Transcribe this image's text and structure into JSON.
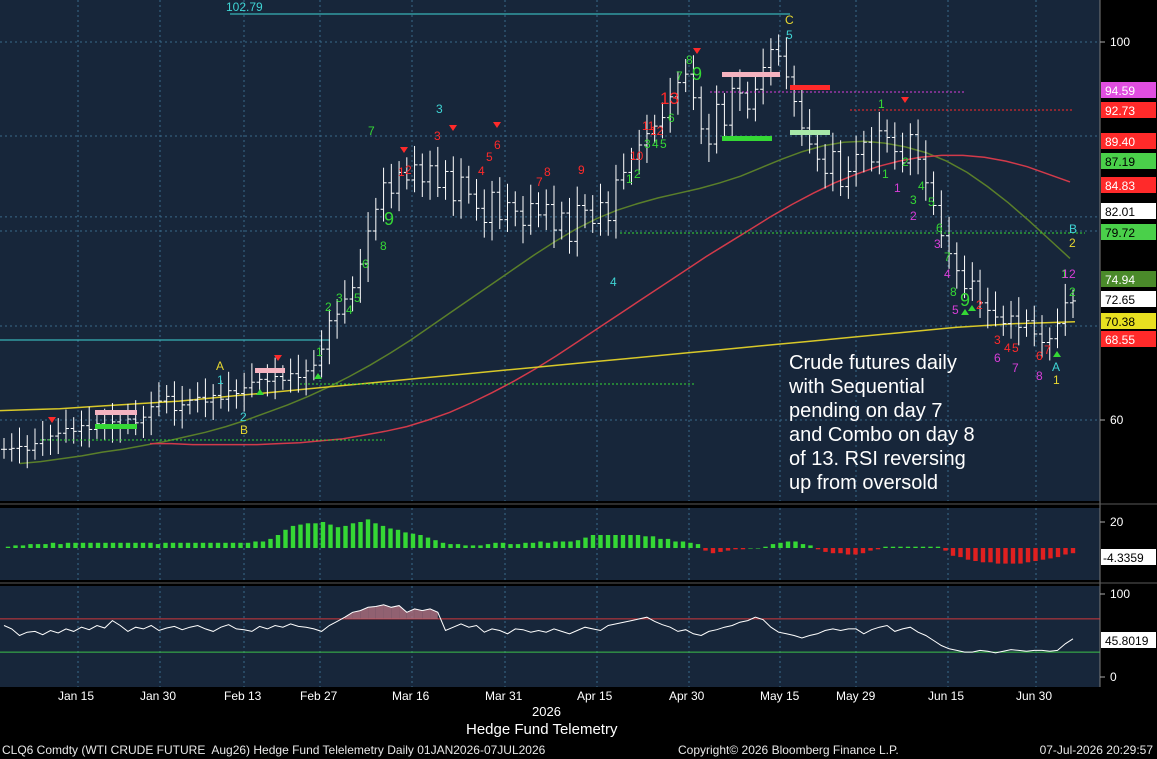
{
  "window": {
    "ticker_line": "CLQ6 Comdty (WTI CRUDE FUTURE  Aug26) Hedge Fund Telelemetry Daily 01JAN2026-07JUL2026",
    "copyright": "Copyright© 2026 Bloomberg Finance L.P.",
    "timestamp": "07-Jul-2026 20:29:57",
    "year_label": "2026",
    "subtitle": "Hedge Fund Telemetry"
  },
  "annotation": {
    "lines": [
      "Crude futures daily",
      "with Sequential",
      "pending on day 7",
      "and Combo on day 8",
      "of 13.  RSI reversing",
      "up from oversold"
    ]
  },
  "colors": {
    "panel_bg": "#17263a",
    "candle": "#ffffff",
    "ma_short": "#5a7f2a",
    "ma_mid": "#d23a4a",
    "ma_long": "#d8c829",
    "seq_green": "#35d835",
    "seq_red": "#ff2a2a",
    "seq_magenta": "#d93ed9",
    "cyan": "#3fd4d4",
    "rsi_line": "#ffffff",
    "rsi_upper": "#d0383a",
    "rsi_lower": "#3cc04a"
  },
  "chart_data": [
    {
      "type": "candlestick",
      "title": "",
      "x_ticks": [
        "Jan 15",
        "Jan 30",
        "Feb 13",
        "Feb 27",
        "Mar 16",
        "Mar 31",
        "Apr 15",
        "Apr 30",
        "May 15",
        "May 29",
        "Jun 15",
        "Jun 30"
      ],
      "y_ticks": [
        60,
        100
      ],
      "ylim": [
        52,
        106
      ],
      "top_label": "102.79",
      "price_closes": [
        56.9,
        57.0,
        57.2,
        56.8,
        57.5,
        57.9,
        58.3,
        58.6,
        59.1,
        58.8,
        59.4,
        59.0,
        59.6,
        59.2,
        59.8,
        59.5,
        60.1,
        59.7,
        60.3,
        61.4,
        62.0,
        62.5,
        61.0,
        61.6,
        62.1,
        62.4,
        61.9,
        62.6,
        62.2,
        63.1,
        62.8,
        63.4,
        64.0,
        64.3,
        64.1,
        64.6,
        64.2,
        64.9,
        64.5,
        65.2,
        65.8,
        67.5,
        70.5,
        71.2,
        72.8,
        74.0,
        76.5,
        80.0,
        82.3,
        85.1,
        84.0,
        86.2,
        85.4,
        87.0,
        85.2,
        86.9,
        84.6,
        86.3,
        83.2,
        85.7,
        83.9,
        82.4,
        80.9,
        84.1,
        81.2,
        83.0,
        82.1,
        80.6,
        82.9,
        81.7,
        82.8,
        80.1,
        81.9,
        78.9,
        82.7,
        82.2,
        80.8,
        83.0,
        81.1,
        85.4,
        86.2,
        87.6,
        89.1,
        90.3,
        91.1,
        92.0,
        94.2,
        95.7,
        96.6,
        94.1,
        90.8,
        89.2,
        93.4,
        91.2,
        95.1,
        94.6,
        92.9,
        95.0,
        97.3,
        99.2,
        98.5,
        96.3,
        93.7,
        90.9,
        89.2,
        87.6,
        86.1,
        88.4,
        84.7,
        86.3,
        88.1,
        89.4,
        87.3,
        90.6,
        89.9,
        88.4,
        87.2,
        90.2,
        87.6,
        85.1,
        82.7,
        79.5,
        77.6,
        75.8,
        73.9,
        74.7,
        72.4,
        71.6,
        70.9,
        70.2,
        71.0,
        69.8,
        70.5,
        69.1,
        68.2,
        68.6,
        70.2,
        72.4,
        72.6
      ],
      "series": [
        {
          "name": "",
          "values": [
            55.4,
            55.6,
            55.9,
            56.2,
            56.6,
            56.9,
            57.3,
            57.7,
            58.2,
            58.7,
            59.3,
            60.0,
            60.8,
            61.6,
            62.5,
            63.5,
            64.6,
            65.8,
            67.1,
            68.5,
            70.0,
            71.5,
            73.0,
            74.5,
            76.0,
            77.5,
            78.9,
            80.2,
            81.3,
            82.2,
            82.9,
            83.5,
            84.0,
            84.5,
            85.1,
            85.8,
            86.7,
            87.6,
            88.4,
            89.0,
            89.4,
            89.5,
            89.3,
            88.9,
            88.3,
            87.4,
            86.2,
            84.7,
            83.0,
            81.1,
            79.1,
            77.1
          ]
        },
        {
          "name": "",
          "values": [
            57.5,
            57.5,
            57.4,
            57.4,
            57.4,
            57.4,
            57.5,
            57.6,
            57.8,
            58.0,
            58.4,
            58.8,
            59.3,
            60.0,
            60.8,
            61.8,
            62.9,
            64.1,
            65.4,
            66.8,
            68.3,
            69.8,
            71.3,
            72.8,
            74.3,
            75.8,
            77.3,
            78.7,
            80.1,
            81.5,
            82.8,
            84.0,
            85.1,
            86.0,
            86.8,
            87.4,
            87.8,
            88.0,
            88.0,
            87.8,
            87.4,
            86.8,
            86.0,
            85.2
          ]
        },
        {
          "name": "",
          "values": [
            61.0,
            61.1,
            61.2,
            61.4,
            61.6,
            61.8,
            62.0,
            62.3,
            62.6,
            62.9,
            63.2,
            63.5,
            63.8,
            64.1,
            64.4,
            64.7,
            65.0,
            65.3,
            65.6,
            65.9,
            66.2,
            66.5,
            66.8,
            67.1,
            67.4,
            67.7,
            68.0,
            68.3,
            68.6,
            68.9,
            69.2,
            69.5,
            69.8,
            70.0,
            70.2,
            70.3,
            70.4
          ]
        }
      ],
      "right_labels": [
        "94.59",
        "92.73",
        "89.40",
        "87.19",
        "84.83",
        "82.01",
        "79.72",
        "74.94",
        "72.65",
        "70.38",
        "68.55"
      ]
    },
    {
      "type": "bar",
      "title": "",
      "y_ticks": [
        20
      ],
      "last_value": "-4.3359",
      "values": [
        1,
        2,
        2,
        3,
        3,
        3,
        4,
        3,
        4,
        4,
        4,
        4,
        4,
        4,
        4,
        4,
        4,
        4,
        4,
        4,
        3,
        4,
        4,
        4,
        4,
        4,
        4,
        4,
        4,
        4,
        4,
        4,
        4,
        5,
        5,
        7,
        10,
        14,
        17,
        18,
        19,
        19,
        20,
        18,
        16,
        17,
        19,
        20,
        22,
        19,
        17,
        15,
        14,
        12,
        11,
        10,
        8,
        6,
        4,
        3,
        3,
        2,
        2,
        2,
        3,
        4,
        4,
        3,
        3,
        4,
        4,
        5,
        4,
        5,
        5,
        5,
        6,
        8,
        10,
        10,
        10,
        10,
        10,
        10,
        10,
        9,
        9,
        7,
        7,
        5,
        5,
        4,
        3,
        -2,
        -4,
        -3,
        -2,
        -1,
        -1,
        0,
        0,
        1,
        3,
        4,
        5,
        5,
        3,
        2,
        -1,
        -3,
        -4,
        -4,
        -5,
        -5,
        -4,
        -2,
        -1,
        1,
        1,
        1,
        1,
        1,
        1,
        1,
        1,
        -2,
        -6,
        -7,
        -9,
        -10,
        -11,
        -11,
        -12,
        -12,
        -12,
        -12,
        -11,
        -10,
        -9,
        -8,
        -7,
        -5,
        -4
      ]
    },
    {
      "type": "line",
      "title": "",
      "y_ticks": [
        0,
        100
      ],
      "ylim": [
        0,
        100
      ],
      "last_value": "45.8019",
      "levels": [
        70,
        30
      ],
      "values": [
        62,
        58,
        50,
        54,
        55,
        51,
        56,
        53,
        58,
        55,
        60,
        57,
        62,
        59,
        68,
        62,
        55,
        60,
        58,
        62,
        56,
        59,
        61,
        57,
        60,
        62,
        58,
        55,
        60,
        63,
        58,
        57,
        55,
        61,
        58,
        62,
        60,
        64,
        61,
        60,
        58,
        55,
        62,
        67,
        72,
        78,
        80,
        84,
        85,
        87,
        84,
        86,
        78,
        82,
        80,
        82,
        78,
        56,
        60,
        64,
        60,
        62,
        54,
        58,
        56,
        52,
        58,
        57,
        54,
        56,
        54,
        58,
        55,
        52,
        56,
        60,
        58,
        56,
        62,
        64,
        66,
        68,
        70,
        72,
        67,
        63,
        60,
        55,
        57,
        52,
        50,
        55,
        57,
        60,
        62,
        66,
        68,
        72,
        69,
        60,
        54,
        52,
        50,
        47,
        50,
        52,
        56,
        58,
        56,
        58,
        58,
        52,
        57,
        60,
        62,
        55,
        58,
        60,
        54,
        50,
        44,
        38,
        34,
        32,
        30,
        30,
        32,
        31,
        29,
        31,
        33,
        32,
        31,
        32,
        32,
        31,
        32,
        40,
        46
      ]
    }
  ]
}
